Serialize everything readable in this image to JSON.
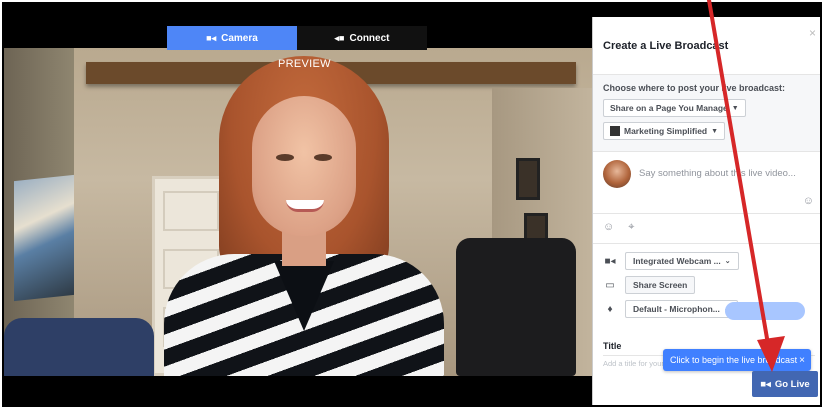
{
  "preview": {
    "tabs": [
      {
        "label": "Camera",
        "icon": "video-camera-icon",
        "active": true
      },
      {
        "label": "Connect",
        "icon": "connect-icon",
        "active": false
      }
    ],
    "label": "PREVIEW"
  },
  "broadcast_panel": {
    "title": "Create a Live Broadcast",
    "post_location_label": "Choose where to post your live broadcast:",
    "share_option": "Share on a Page You Manage",
    "page_name": "Marketing Simplified",
    "composer_placeholder": "Say something about this live video...",
    "devices": {
      "camera": "Integrated Webcam ...",
      "share_screen": "Share Screen",
      "microphone": "Default - Microphon..."
    },
    "title_label": "Title",
    "title_placeholder": "Add a title for your live broadcast..."
  },
  "tooltip": {
    "text": "Click to begin the live broadcast",
    "close": "×"
  },
  "go_live": {
    "label": "Go Live"
  },
  "colors": {
    "accent_blue": "#4e86f7",
    "go_live_blue": "#4267b2",
    "tooltip_blue": "#4080ff",
    "annotation_arrow": "#d62728"
  }
}
